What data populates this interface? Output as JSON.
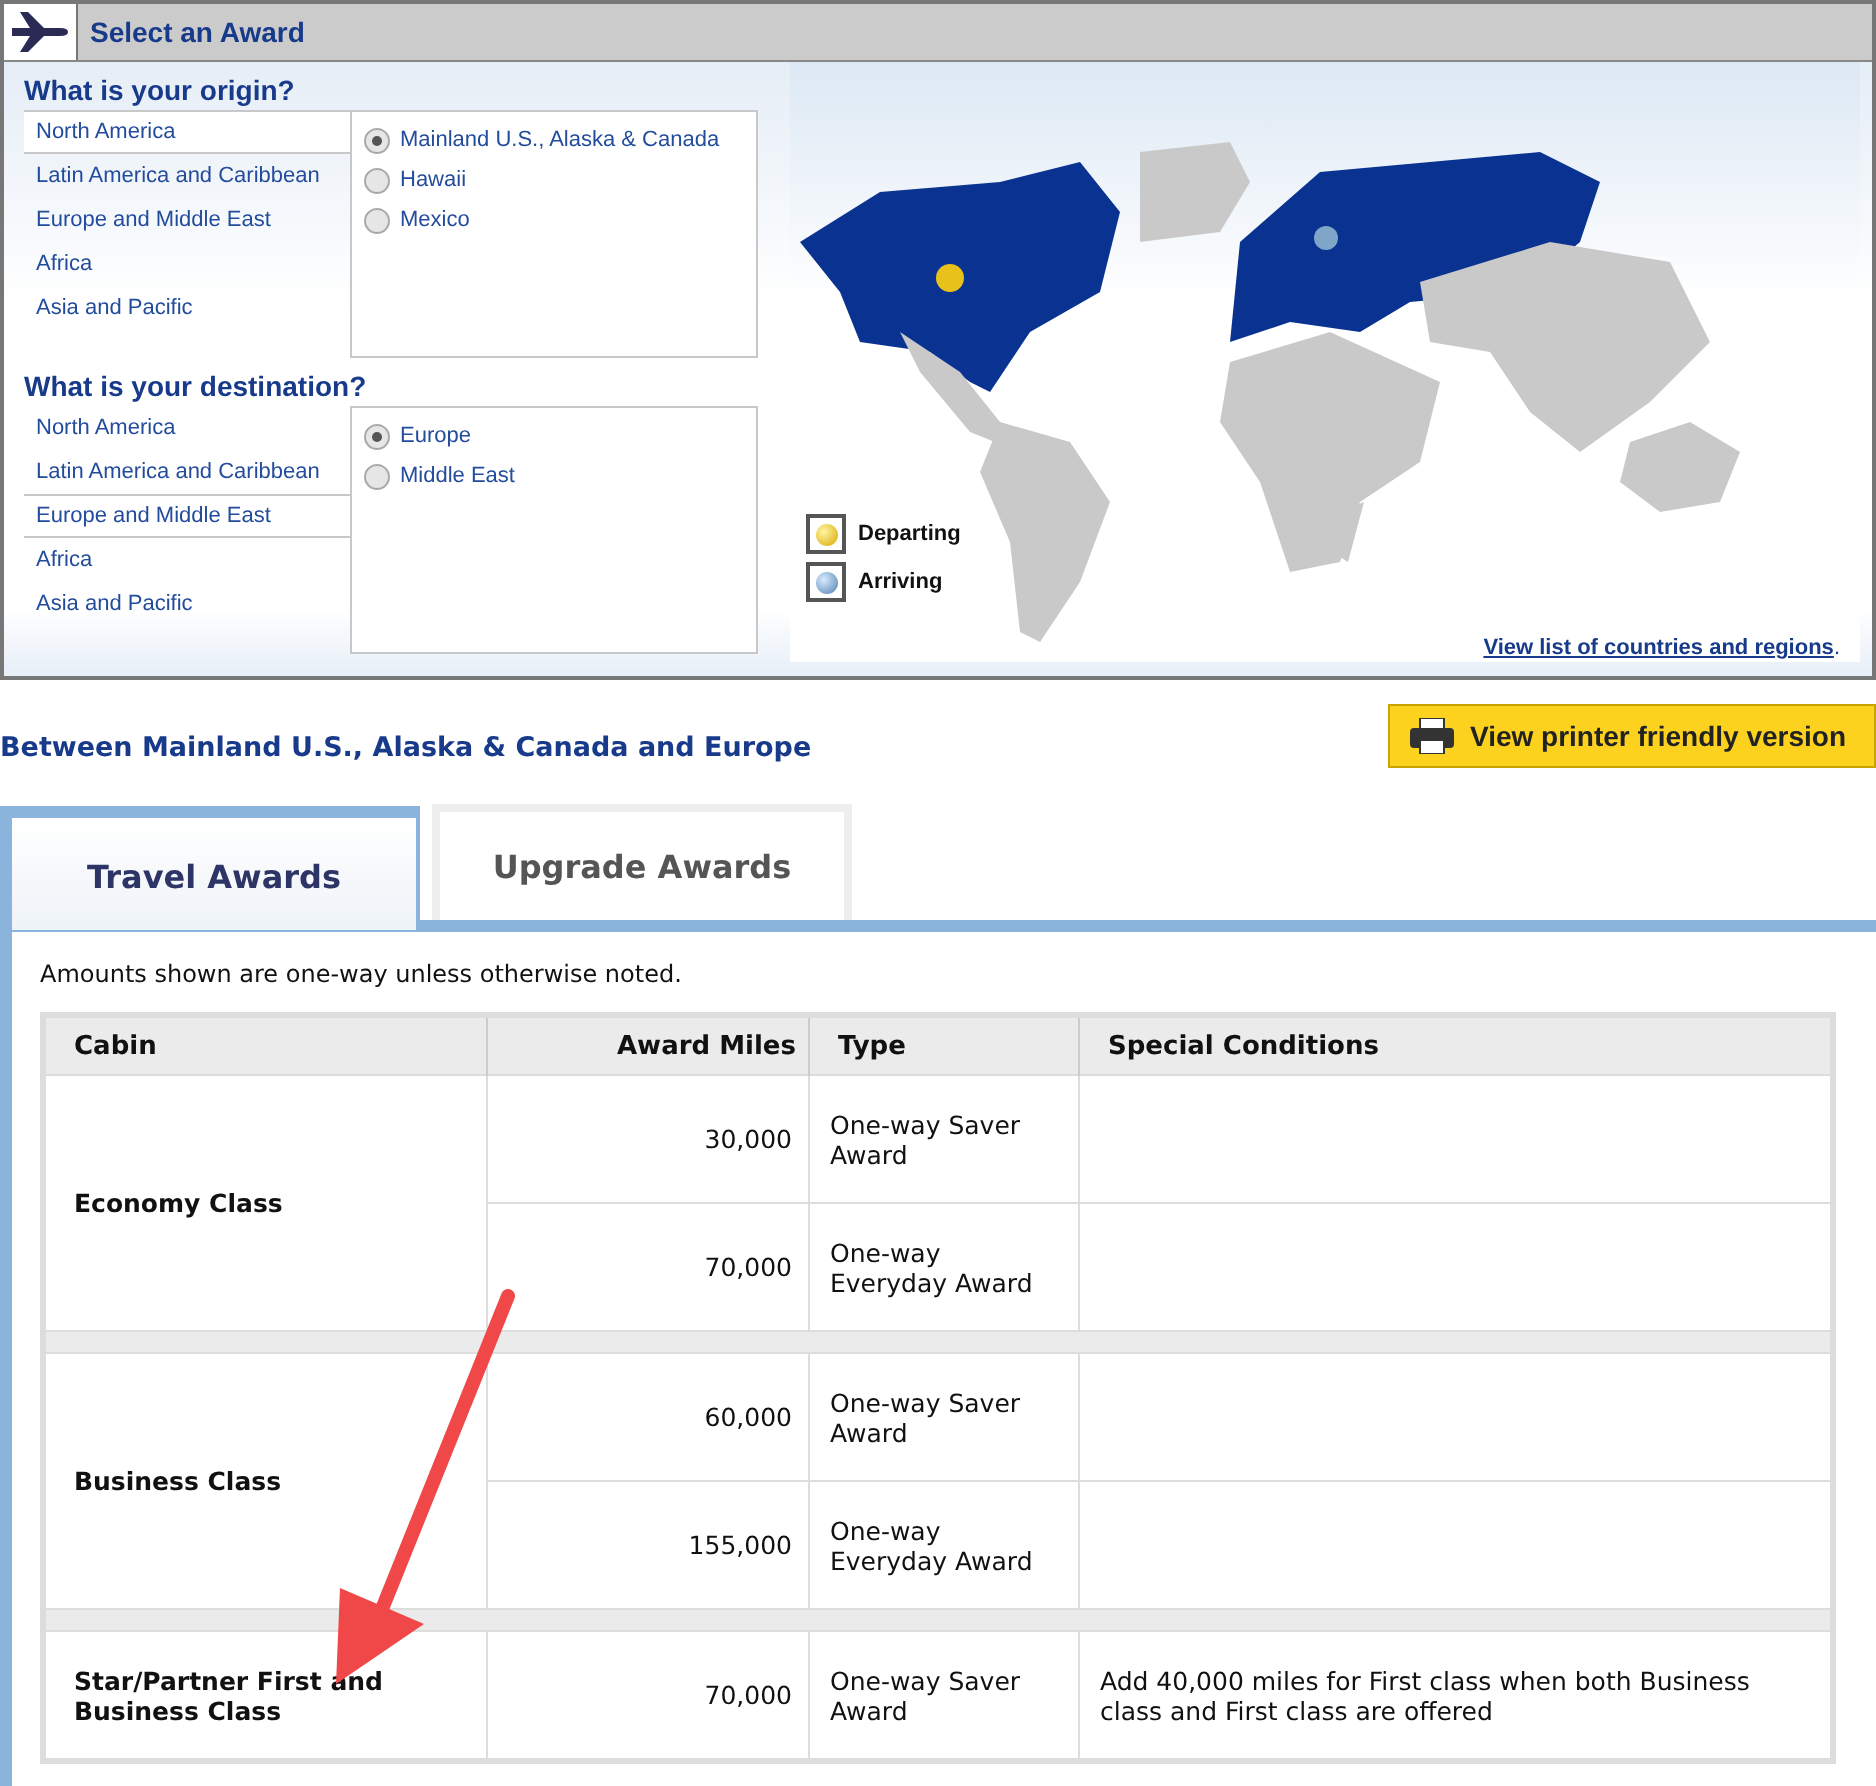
{
  "header": {
    "title": "Select an Award"
  },
  "origin": {
    "heading": "What is your origin?",
    "regions": [
      {
        "label": "North America",
        "selected": true
      },
      {
        "label": "Latin America and Caribbean",
        "selected": false
      },
      {
        "label": "Europe and Middle East",
        "selected": false
      },
      {
        "label": "Africa",
        "selected": false
      },
      {
        "label": "Asia and Pacific",
        "selected": false
      }
    ],
    "options": [
      {
        "label": "Mainland U.S., Alaska & Canada",
        "selected": true
      },
      {
        "label": "Hawaii",
        "selected": false
      },
      {
        "label": "Mexico",
        "selected": false
      }
    ]
  },
  "destination": {
    "heading": "What is your destination?",
    "regions": [
      {
        "label": "North America",
        "selected": false
      },
      {
        "label": "Latin America and Caribbean",
        "selected": false
      },
      {
        "label": "Europe and Middle East",
        "selected": true
      },
      {
        "label": "Africa",
        "selected": false
      },
      {
        "label": "Asia and Pacific",
        "selected": false
      }
    ],
    "options": [
      {
        "label": "Europe",
        "selected": true
      },
      {
        "label": "Middle East",
        "selected": false
      }
    ]
  },
  "legend": [
    {
      "kind": "departing",
      "label": "Departing"
    },
    {
      "kind": "arriving",
      "label": "Arriving"
    }
  ],
  "map_link": {
    "label": "View list of countries and regions",
    "suffix": "."
  },
  "route_title": "Between Mainland U.S., Alaska & Canada and Europe",
  "print_button": "View printer friendly version",
  "tabs": [
    {
      "label": "Travel Awards",
      "selected": true
    },
    {
      "label": "Upgrade Awards",
      "selected": false
    }
  ],
  "note": "Amounts shown are one-way unless otherwise noted.",
  "table": {
    "columns": [
      "Cabin",
      "Award Miles",
      "Type",
      "Special Conditions"
    ],
    "groups": [
      {
        "cabin": "Economy Class",
        "rows": [
          {
            "miles": "30,000",
            "type": "One-way Saver Award"
          },
          {
            "miles": "70,000",
            "type": "One-way Everyday Award"
          }
        ]
      },
      {
        "cabin": "Business Class",
        "rows": [
          {
            "miles": "60,000",
            "type": "One-way Saver Award"
          },
          {
            "miles": "155,000",
            "type": "One-way Everyday Award"
          }
        ]
      },
      {
        "cabin": "Star/Partner First and Business Class",
        "rows": [
          {
            "miles": "70,000",
            "type": "One-way Saver Award",
            "conditions": "Add 40,000 miles for First class when both Business class and First class are offered"
          }
        ]
      }
    ]
  }
}
